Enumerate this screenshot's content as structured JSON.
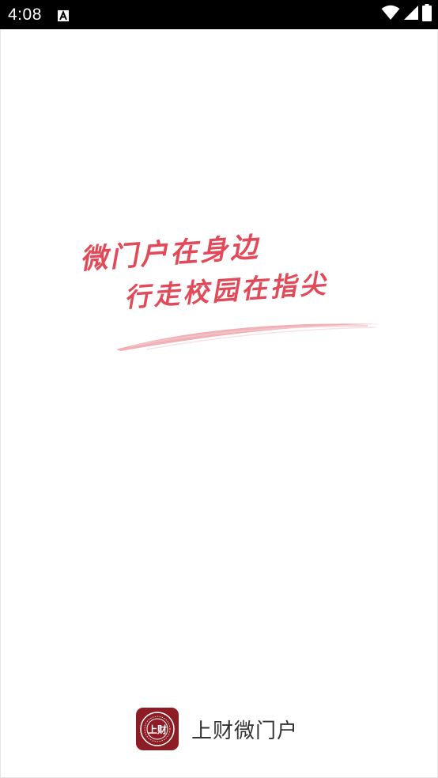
{
  "status_bar": {
    "time": "4:08",
    "notification_icon": "font-a-icon",
    "wifi_icon": "wifi-icon",
    "signal_icon": "cell-signal-icon",
    "battery_icon": "battery-icon"
  },
  "splash": {
    "slogan_line_1": "微门户在身边",
    "slogan_line_2": "行走校园在指尖",
    "slogan_color": "#e14a59"
  },
  "brand": {
    "logo_icon": "university-seal-icon",
    "logo_text": "上财",
    "app_name": "上财微门户",
    "logo_color": "#8d1c24"
  }
}
